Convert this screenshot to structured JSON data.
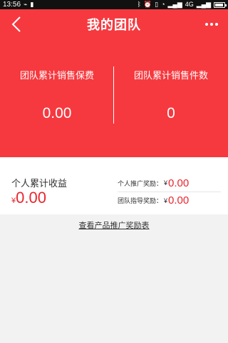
{
  "status_bar": {
    "time": "13:56",
    "network": "4G"
  },
  "header": {
    "title": "我的团队"
  },
  "stats": {
    "fee_label": "团队累计销售保费",
    "fee_value": "0.00",
    "count_label": "团队累计销售件数",
    "count_value": "0"
  },
  "income": {
    "label": "个人累计收益",
    "currency": "¥",
    "value": "0.00"
  },
  "rewards": {
    "personal_label": "个人推广奖励：",
    "personal_currency": "¥",
    "personal_value": "0.00",
    "team_label": "团队指导奖励：",
    "team_currency": "¥",
    "team_value": "0.00"
  },
  "link_text": "查看产品推广奖励表",
  "colors": {
    "accent": "#f6393f",
    "value_red": "#e8262e"
  }
}
